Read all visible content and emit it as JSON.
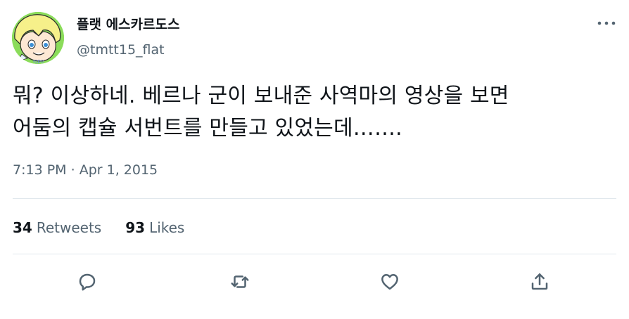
{
  "author": {
    "display_name": "플랫 에스카르도스",
    "handle": "@tmtt15_flat",
    "avatar_icon": "anime-character-avatar"
  },
  "menu_icon": "more-dots-icon",
  "tweet": {
    "text": "뭐? 이상하네. 베르나 군이 보내준 사역마의 영상을 보면\n어둠의 캡슐 서번트를 만들고 있었는데…….",
    "time": "7:13 PM",
    "separator": "·",
    "date": "Apr 1, 2015"
  },
  "stats": {
    "retweets_count": "34",
    "retweets_label": "Retweets",
    "likes_count": "93",
    "likes_label": "Likes"
  },
  "actions": {
    "reply_icon": "reply-icon",
    "retweet_icon": "retweet-icon",
    "like_icon": "heart-icon",
    "share_icon": "share-icon"
  },
  "colors": {
    "text": "#0f1419",
    "secondary": "#536471",
    "divider": "#e1e8ed",
    "avatar_bg": "#7ed957"
  }
}
